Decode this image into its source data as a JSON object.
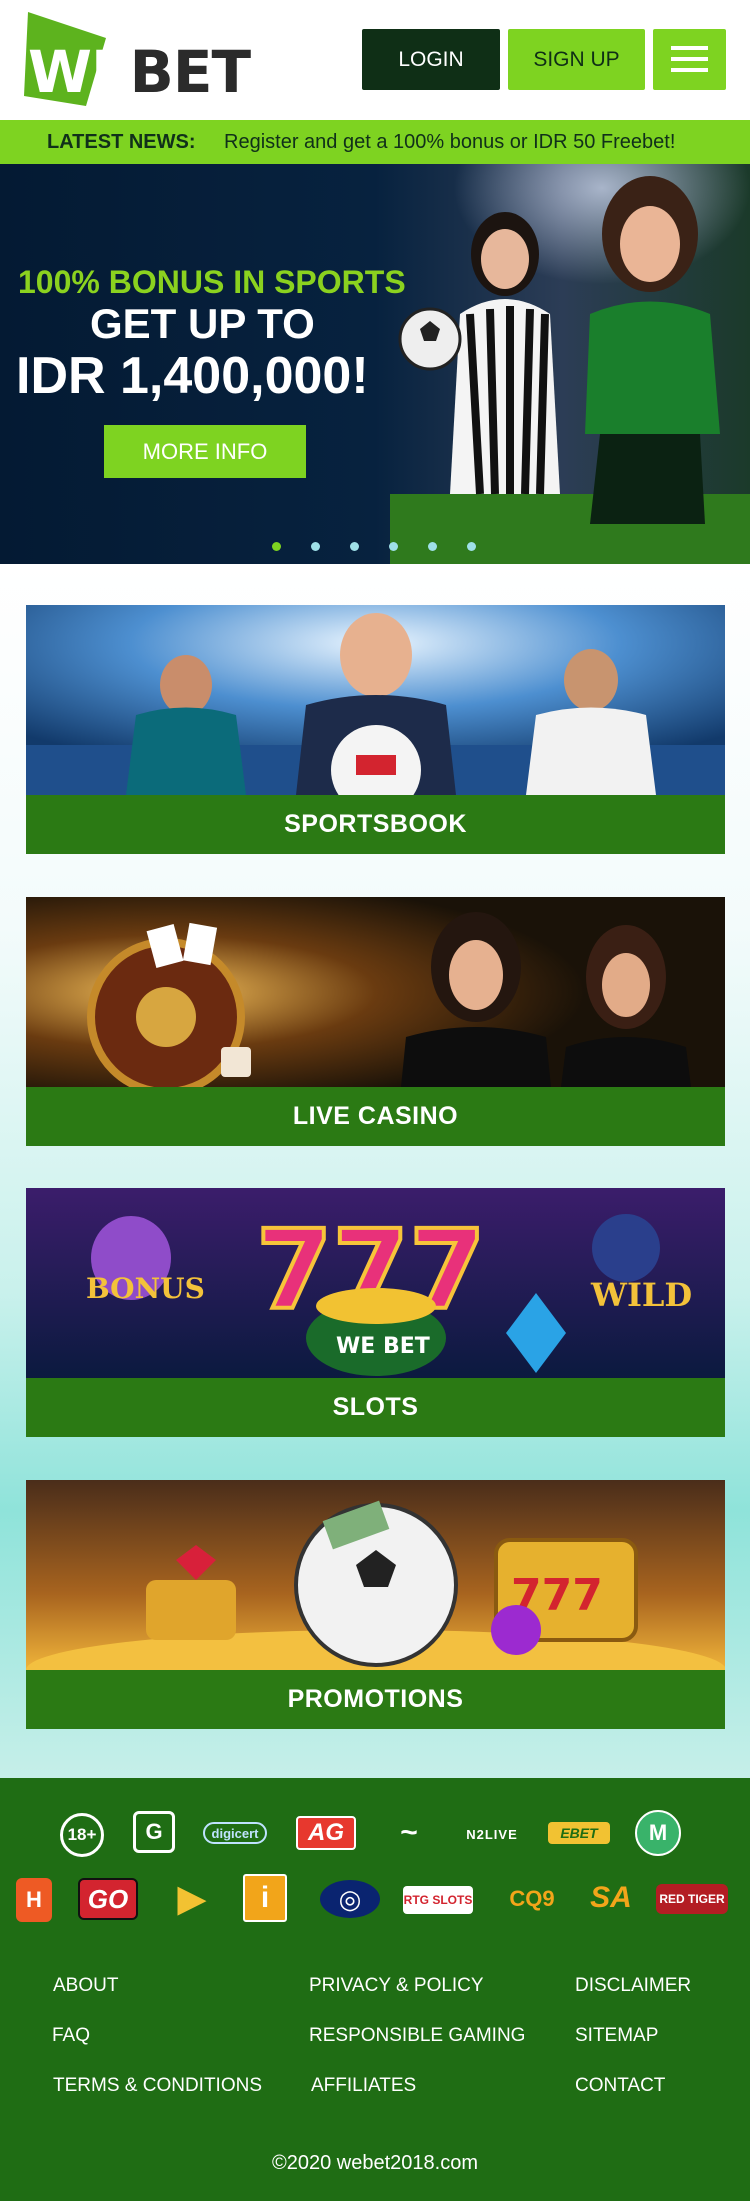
{
  "header": {
    "logo_we": "WE",
    "logo_bet": "BET",
    "login_label": "LOGIN",
    "signup_label": "SIGN UP"
  },
  "news": {
    "label": "LATEST NEWS:",
    "text": "Register and get a 100% bonus or IDR 50 Freebet!"
  },
  "hero": {
    "line1": "100% BONUS IN SPORTS",
    "line2": "GET UP TO",
    "line3": "IDR 1,400,000!",
    "button": "MORE INFO",
    "slides": 6,
    "active_slide": 1
  },
  "categories": [
    {
      "label": "SPORTSBOOK"
    },
    {
      "label": "LIVE CASINO"
    },
    {
      "label": "SLOTS"
    },
    {
      "label": "PROMOTIONS"
    }
  ],
  "partners_row1": [
    "18+",
    "G",
    "digicert",
    "AG",
    "~",
    "N2LIVE",
    "EBET",
    "M"
  ],
  "partners_row2": [
    "H",
    "GO",
    "▶",
    "i",
    "◎",
    "RTG SLOTS",
    "CQ9",
    "SA",
    "RED TIGER"
  ],
  "footer": {
    "links": {
      "about": "ABOUT",
      "faq": "FAQ",
      "terms": "TERMS & CONDITIONS",
      "privacy": "PRIVACY & POLICY",
      "responsible": "RESPONSIBLE GAMING",
      "affiliates": "AFFILIATES",
      "disclaimer": "DISCLAIMER",
      "sitemap": "SITEMAP",
      "contact": "CONTACT"
    },
    "copyright": "©2020 webet2018.com"
  },
  "colors": {
    "brand_green": "#7ed321",
    "dark_green": "#0f2f16",
    "footer_green": "#1f6d14",
    "card_bar": "#2b7a14",
    "hero_navy": "#06203a"
  }
}
